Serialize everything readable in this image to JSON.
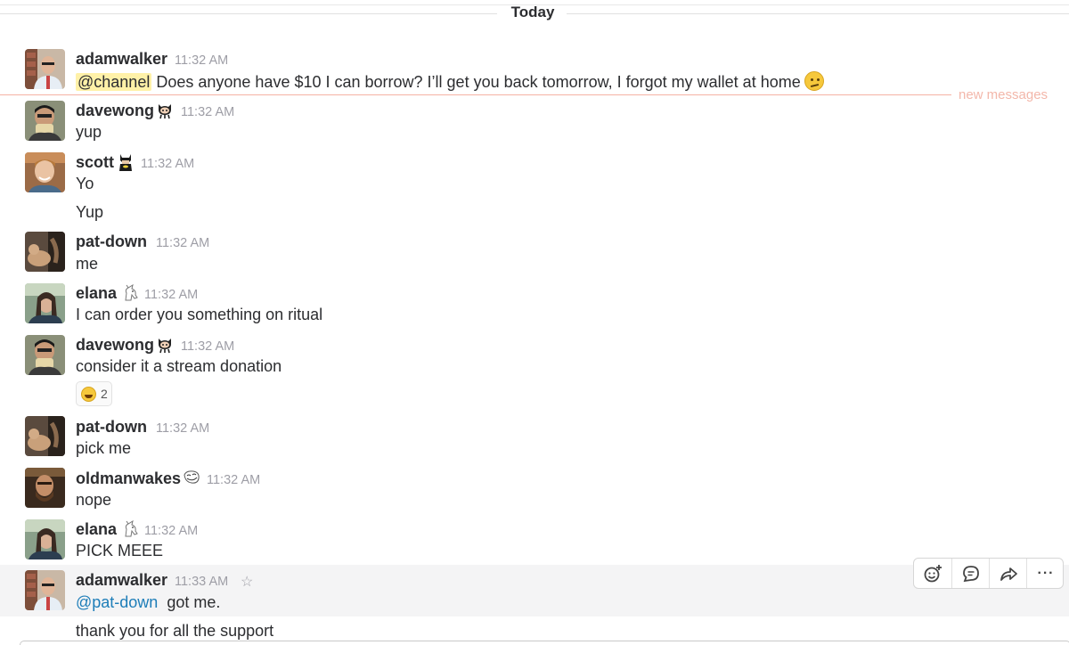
{
  "day_divider": {
    "label": "Today"
  },
  "new_messages": {
    "label": "new messages"
  },
  "messages": [
    {
      "user": "adamwalker",
      "time": "11:32 AM",
      "mention": "@channel",
      "text": "Does anyone have $10 I can borrow? I’ll get you back tomorrow, I forgot my wallet at home",
      "emoji": "confused-face-emoji"
    },
    {
      "user": "davewong",
      "badge": "octocat-icon",
      "time": "11:32 AM",
      "text": "yup"
    },
    {
      "user": "scott",
      "badge": "batman-icon",
      "time": "11:32 AM",
      "text": "Yo",
      "followup": "Yup"
    },
    {
      "user": "pat-down",
      "time": "11:32 AM",
      "text": "me"
    },
    {
      "user": "elana",
      "badge": "unicorn-icon",
      "time": "11:32 AM",
      "text": "I can order you something on ritual"
    },
    {
      "user": "davewong",
      "badge": "octocat-icon",
      "time": "11:32 AM",
      "text": "consider it a stream donation",
      "reaction": {
        "emoji": "joy-emoji",
        "count": "2"
      }
    },
    {
      "user": "pat-down",
      "time": "11:32 AM",
      "text": "pick me"
    },
    {
      "user": "oldmanwakes",
      "badge": "trollface-icon",
      "time": "11:32 AM",
      "text": "nope"
    },
    {
      "user": "elana",
      "badge": "unicorn-icon",
      "time": "11:32 AM",
      "text": "PICK MEEE"
    },
    {
      "user": "adamwalker",
      "time": "11:33 AM",
      "mention": "@pat-down",
      "text": "got me.",
      "followup": "thank you for all the support"
    }
  ],
  "message_actions": [
    {
      "icon": "add-reaction-icon"
    },
    {
      "icon": "start-thread-icon"
    },
    {
      "icon": "share-message-icon"
    },
    {
      "icon": "more-actions-icon",
      "label": "···"
    }
  ],
  "star_icon": {
    "glyph": "☆"
  },
  "colors": {
    "mention_highlight": "#fff1a8",
    "mention_link": "#1d7db8",
    "new_messages": "#f3b7aa",
    "timestamp": "#9e9ea6"
  }
}
